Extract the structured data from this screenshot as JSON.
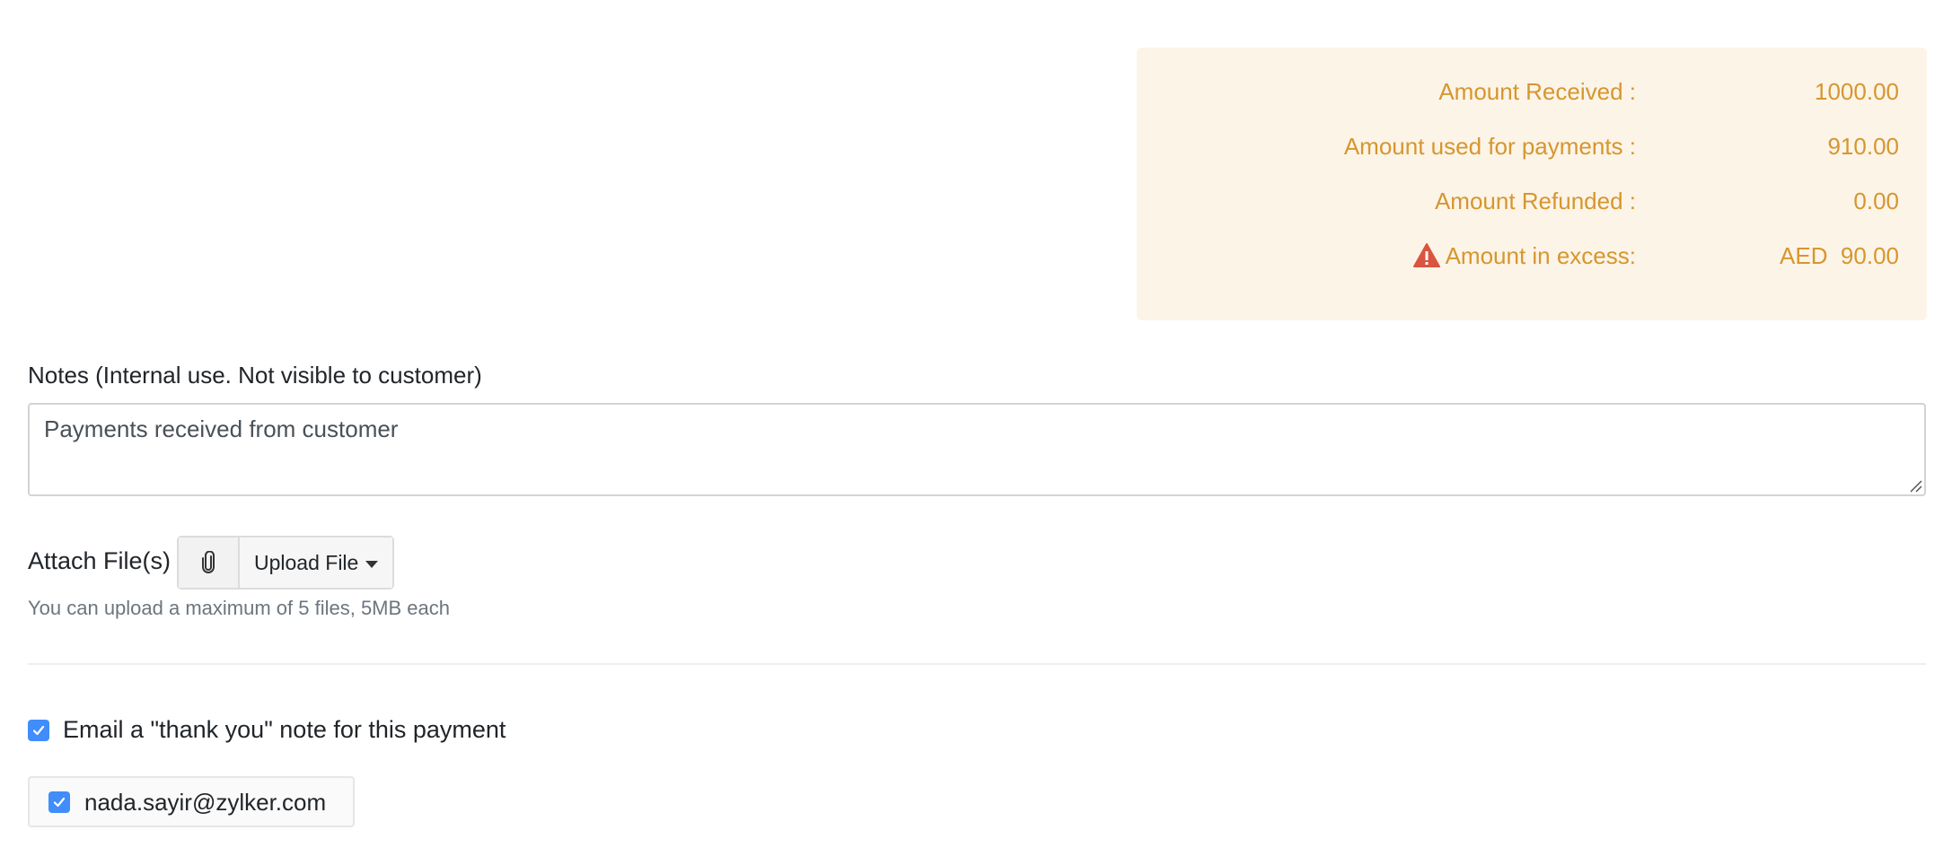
{
  "summary": {
    "amount_received_label": "Amount Received :",
    "amount_received_value": "1000.00",
    "amount_used_label": "Amount used for payments :",
    "amount_used_value": "910.00",
    "amount_refunded_label": "Amount Refunded :",
    "amount_refunded_value": "0.00",
    "amount_excess_label": "Amount in excess:",
    "amount_excess_value": "AED  90.00",
    "text_color": "#d6962f",
    "background_color": "#fcf4e7",
    "warning_icon": "warning-triangle-icon",
    "warning_color": "#d9553f"
  },
  "notes": {
    "label": "Notes (Internal use. Not visible to customer)",
    "value": "Payments received from customer"
  },
  "attachments": {
    "label": "Attach File(s)",
    "attach_icon": "paperclip-icon",
    "upload_button_label": "Upload File",
    "hint": "You can upload a maximum of 5 files, 5MB each"
  },
  "email_thank_you": {
    "checked": true,
    "label": "Email a \"thank you\" note for this payment",
    "recipients": [
      {
        "email": "nada.sayir@zylker.com",
        "checked": true
      }
    ]
  },
  "accent_color": "#408dfb"
}
